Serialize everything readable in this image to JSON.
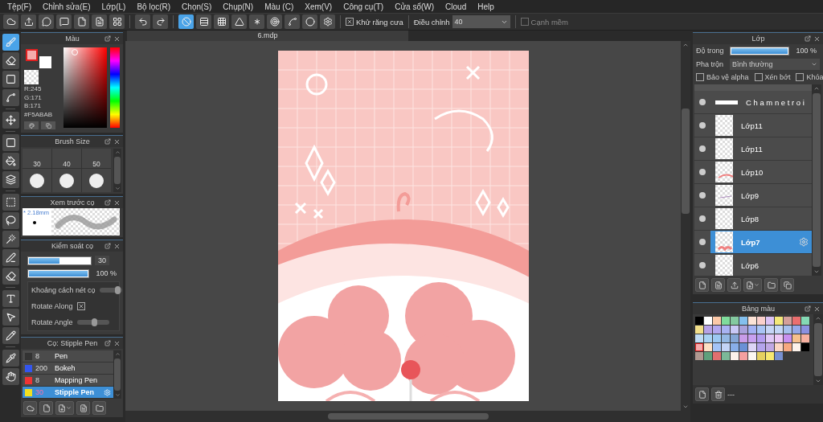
{
  "menu": [
    "Tệp(F)",
    "Chỉnh sửa(E)",
    "Lớp(L)",
    "Bộ lọc(R)",
    "Chọn(S)",
    "Chụp(N)",
    "Màu (C)",
    "Xem(V)",
    "Công cụ(T)",
    "Cửa sổ(W)",
    "Cloud",
    "Help"
  ],
  "toolbar": {
    "snaps": [
      {
        "selected": true
      },
      {
        "selected": false
      },
      {
        "selected": false
      },
      {
        "selected": false
      },
      {
        "selected": false
      },
      {
        "selected": false
      },
      {
        "selected": false
      },
      {
        "selected": false
      },
      {
        "selected": false
      }
    ],
    "antialias": {
      "label": "Khử răng cưa",
      "checked": true
    },
    "correction": {
      "label": "Điều chỉnh",
      "value": "40"
    },
    "soft_edge": {
      "label": "Cạnh mềm",
      "checked": false,
      "disabled": true
    }
  },
  "tools": [
    {
      "selected": true
    },
    {
      "selected": false
    },
    {
      "selected": false
    },
    {
      "selected": false
    },
    {
      "selected": false
    },
    {
      "selected": false
    },
    {
      "selected": false
    },
    {
      "selected": false
    },
    {
      "selected": false
    },
    {
      "selected": false
    },
    {
      "selected": false
    },
    {
      "selected": false
    },
    {
      "selected": false
    },
    {
      "selected": false
    },
    {
      "selected": false
    },
    {
      "selected": false
    },
    {
      "selected": false
    },
    {
      "selected": false
    }
  ],
  "color_panel": {
    "title": "Màu",
    "readout": [
      "R:245",
      "G:171",
      "B:171",
      "#F5ABAB"
    ]
  },
  "brush_size": {
    "title": "Brush Size",
    "sizes": [
      "30",
      "40",
      "50"
    ]
  },
  "brush_preview": {
    "title": "Xem trước cọ",
    "size": "* 2.18mm"
  },
  "brush_control": {
    "title": "Kiểm soát cọ",
    "size": {
      "level": 0.5,
      "value": "30"
    },
    "opacity": {
      "level": 1,
      "value": "100 %"
    },
    "options": [
      {
        "kind": "slider",
        "label": "Khoảng cách nét cọ",
        "level": 0.85
      },
      {
        "kind": "checkbox",
        "label": "Rotate Along",
        "checked": true
      },
      {
        "kind": "slider",
        "label": "Rotate Angle",
        "level": 0.55
      }
    ]
  },
  "brushes": {
    "title": "Cọ: Stipple Pen",
    "items": [
      {
        "size": "8",
        "name": "Pen",
        "color": "#333333",
        "selected": false
      },
      {
        "size": "200",
        "name": "Bokeh",
        "color": "#3355ee",
        "selected": false
      },
      {
        "size": "8",
        "name": "Mapping Pen",
        "color": "#ee3333",
        "selected": false
      },
      {
        "size": "30",
        "name": "Stipple Pen",
        "color": "#f2e020",
        "selected": true
      }
    ]
  },
  "document_tab": "6.mdp",
  "layers_panel": {
    "title": "Lớp",
    "opacity": {
      "label": "Độ trong",
      "level": 1,
      "value": "100 %"
    },
    "blend": {
      "label": "Pha trộn",
      "value": "Bình thường"
    },
    "options": [
      {
        "label": "Bảo vệ alpha",
        "checked": false
      },
      {
        "label": "Xén bớt",
        "checked": false
      },
      {
        "label": "Khóa",
        "checked": false
      }
    ],
    "layers": [
      {
        "name": "C h a m n e t r o i",
        "selected": false
      },
      {
        "name": "Lớp11",
        "selected": false
      },
      {
        "name": "Lớp11",
        "selected": false
      },
      {
        "name": "Lớp10",
        "selected": false
      },
      {
        "name": "Lớp9",
        "selected": false
      },
      {
        "name": "Lớp8",
        "selected": false
      },
      {
        "name": "Lớp7",
        "selected": true
      },
      {
        "name": "Lớp6",
        "selected": false
      }
    ]
  },
  "swatches_panel": {
    "title": "Bảng màu",
    "footer": "---",
    "swatches": [
      {
        "color": "#000000",
        "selected": false
      },
      {
        "color": "#ffffff",
        "selected": false
      },
      {
        "color": "#fcc9a8",
        "selected": false
      },
      {
        "color": "#7fdc9c",
        "selected": false
      },
      {
        "color": "#84c9a0",
        "selected": false
      },
      {
        "color": "#84c0ee",
        "selected": false
      },
      {
        "color": "#fde3d6",
        "selected": false
      },
      {
        "color": "#fbd0cc",
        "selected": false
      },
      {
        "color": "#dcc3f5",
        "selected": false
      },
      {
        "color": "#f5e87a",
        "selected": false
      },
      {
        "color": "#d49f9a",
        "selected": false
      },
      {
        "color": "#ea6e6e",
        "selected": false
      },
      {
        "color": "#84d8b4",
        "selected": false
      },
      {
        "color": "#f2df8a",
        "selected": false
      },
      {
        "color": "#b6a2e6",
        "selected": false
      },
      {
        "color": "#b3a8ef",
        "selected": false
      },
      {
        "color": "#a8b2f2",
        "selected": false
      },
      {
        "color": "#c9c8f6",
        "selected": false
      },
      {
        "color": "#a9a2dc",
        "selected": false
      },
      {
        "color": "#a4b2f4",
        "selected": false
      },
      {
        "color": "#a9c4f5",
        "selected": false
      },
      {
        "color": "#c6d5f6",
        "selected": false
      },
      {
        "color": "#c4d6f7",
        "selected": false
      },
      {
        "color": "#a6c0ee",
        "selected": false
      },
      {
        "color": "#96a8e8",
        "selected": false
      },
      {
        "color": "#8a90e0",
        "selected": false
      },
      {
        "color": "#bfdcf5",
        "selected": false
      },
      {
        "color": "#a8d2f4",
        "selected": false
      },
      {
        "color": "#9cc8f2",
        "selected": false
      },
      {
        "color": "#94b8e4",
        "selected": false
      },
      {
        "color": "#84a6d6",
        "selected": false
      },
      {
        "color": "#c89ce8",
        "selected": false
      },
      {
        "color": "#c8a0f0",
        "selected": false
      },
      {
        "color": "#b49cf0",
        "selected": false
      },
      {
        "color": "#e0c8f6",
        "selected": false
      },
      {
        "color": "#eec8f6",
        "selected": false
      },
      {
        "color": "#c890f0",
        "selected": false
      },
      {
        "color": "#f6c08c",
        "selected": false
      },
      {
        "color": "#f6b0a0",
        "selected": false
      },
      {
        "color": "#f5abab",
        "selected": true
      },
      {
        "color": "#fde0c4",
        "selected": false
      },
      {
        "color": "#a4c4f6",
        "selected": false
      },
      {
        "color": "#c4d4f6",
        "selected": false
      },
      {
        "color": "#88aee8",
        "selected": false
      },
      {
        "color": "#6a90d6",
        "selected": false
      },
      {
        "color": "#ddd4f6",
        "selected": false
      },
      {
        "color": "#b4a4ec",
        "selected": false
      },
      {
        "color": "#c0a8e4",
        "selected": false
      },
      {
        "color": "#fcd6c4",
        "selected": false
      },
      {
        "color": "#f6a880",
        "selected": false
      },
      {
        "color": "#fcf2ea",
        "selected": false
      },
      {
        "color": "#000000",
        "selected": false
      },
      {
        "color": "#b09890",
        "selected": false
      },
      {
        "color": "#5fa07c",
        "selected": false
      },
      {
        "color": "#e07070",
        "selected": false
      },
      {
        "color": "#7cb898",
        "selected": false
      },
      {
        "color": "#fcf0ea",
        "selected": false
      },
      {
        "color": "#f5a0a0",
        "selected": false
      },
      {
        "color": "#fcf6f0",
        "selected": false
      },
      {
        "color": "#e6d060",
        "selected": false
      },
      {
        "color": "#f8e870",
        "selected": false
      },
      {
        "color": "#7890d0",
        "selected": false
      }
    ]
  }
}
